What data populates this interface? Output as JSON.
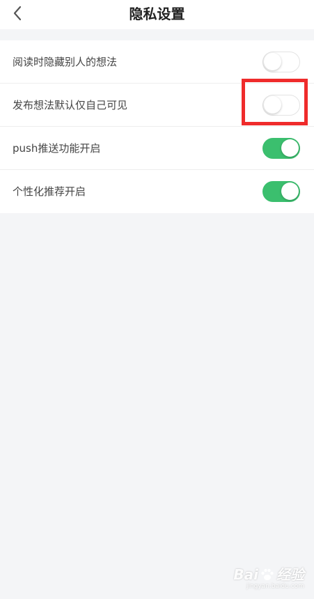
{
  "header": {
    "title": "隐私设置",
    "back_icon": "chevron-left-icon"
  },
  "settings": [
    {
      "label": "阅读时隐藏别人的想法",
      "enabled": false
    },
    {
      "label": "发布想法默认仅自己可见",
      "enabled": false
    },
    {
      "label": "push推送功能开启",
      "enabled": true
    },
    {
      "label": "个性化推荐开启",
      "enabled": true
    }
  ],
  "colors": {
    "toggle_on": "#3bbf6e",
    "highlight": "#ef2b2b",
    "background": "#f4f5f7"
  },
  "watermark": {
    "logo_left": "Bai",
    "logo_right": "经验",
    "url": "jingyan.baidu.com"
  }
}
